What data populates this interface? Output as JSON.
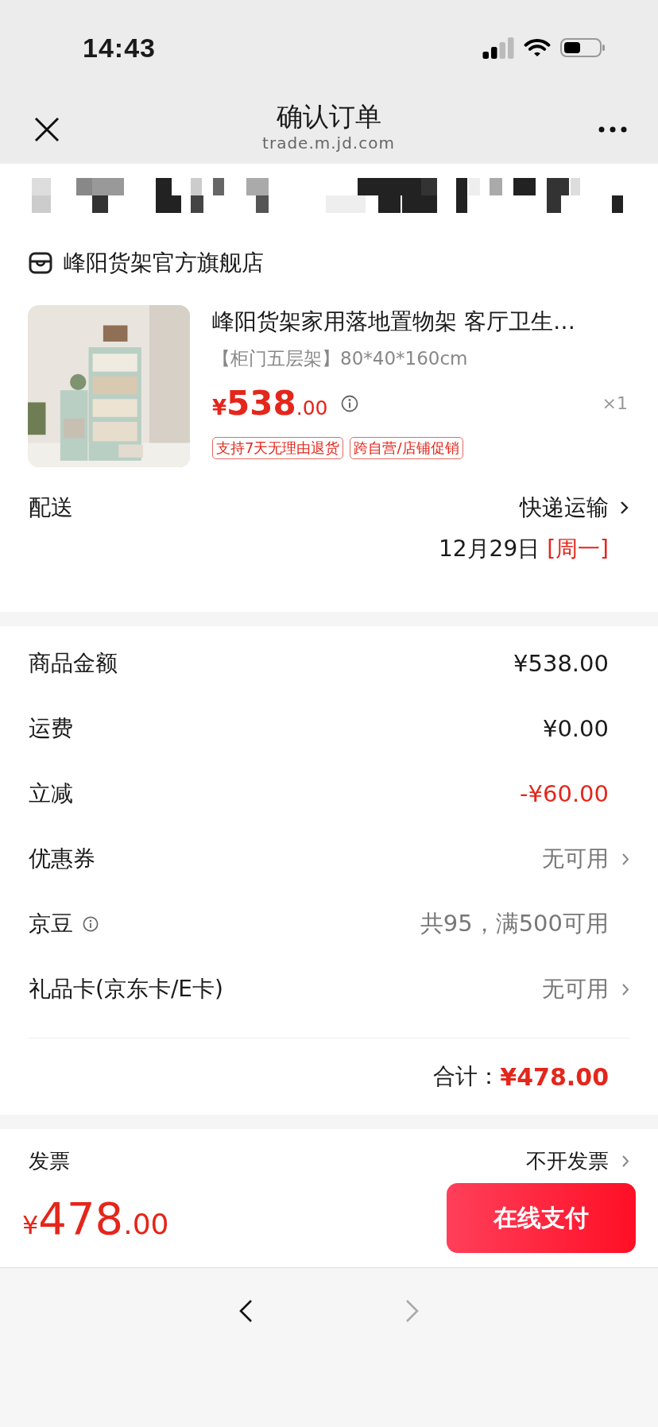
{
  "status_bar": {
    "time": "14:43"
  },
  "nav": {
    "title": "确认订单",
    "url": "trade.m.jd.com"
  },
  "store": {
    "name": "峰阳货架官方旗舰店"
  },
  "product": {
    "title": "峰阳货架家用落地置物架 客厅卫生…",
    "spec": "【柜门五层架】80*40*160cm",
    "price": {
      "currency": "¥",
      "integer": "538",
      "decimals": ".00"
    },
    "quantity": "×1",
    "tags": [
      "支持7天无理由退货",
      "跨自营/店铺促销"
    ]
  },
  "delivery": {
    "label": "配送",
    "method": "快递运输",
    "date": "12月29日",
    "weekday": "[周一]"
  },
  "summary": {
    "rows": [
      {
        "label": "商品金额",
        "value": "¥538.00",
        "kind": "amount",
        "info": false
      },
      {
        "label": "运费",
        "value": "¥0.00",
        "kind": "amount",
        "info": false
      },
      {
        "label": "立减",
        "value": "-¥60.00",
        "kind": "discount",
        "info": false
      },
      {
        "label": "优惠券",
        "value": "无可用",
        "kind": "link",
        "info": false
      },
      {
        "label": "京豆",
        "value": "共95，满500可用",
        "kind": "note",
        "info": true
      },
      {
        "label": "礼品卡(京东卡/E卡)",
        "value": "无可用",
        "kind": "link",
        "info": false
      }
    ],
    "total": {
      "label": "合计：",
      "value": "¥478.00"
    }
  },
  "invoice": {
    "label": "发票",
    "value": "不开发票"
  },
  "checkout": {
    "currency": "¥",
    "integer": "478",
    "decimals": ".00",
    "button": "在线支付"
  },
  "browser_toolbar": {
    "back_disabled": false,
    "forward_disabled": true
  }
}
